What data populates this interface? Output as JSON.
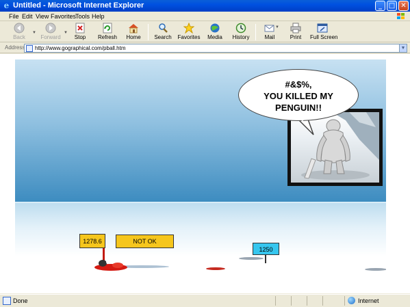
{
  "window": {
    "title": "Untitled - Microsoft Internet Explorer",
    "minimize_glyph": "_",
    "maximize_glyph": "□",
    "close_glyph": "✕"
  },
  "menu": {
    "items": [
      "File",
      "Edit",
      "View",
      "Favorites",
      "Tools",
      "Help"
    ]
  },
  "toolbar": {
    "back": "Back",
    "forward": "Forward",
    "stop": "Stop",
    "refresh": "Refresh",
    "home": "Home",
    "search": "Search",
    "favorites": "Favorites",
    "media": "Media",
    "history": "History",
    "mail": "Mail",
    "print": "Print",
    "fullscreen": "Full Screen"
  },
  "address": {
    "label": "Address",
    "url": "http://www.gographical.com/pball.htm"
  },
  "game": {
    "speech_line1": "#&$%,",
    "speech_line2": "YOU KILLED MY",
    "speech_line3": "PENGUIN!!",
    "distance": "1278.6",
    "result": "NOT OK",
    "target": "1250"
  },
  "status": {
    "text": "Done",
    "zone": "Internet"
  },
  "colors": {
    "sign_yellow": "#f6c61c",
    "sign_cyan": "#36c6ee",
    "blood": "#d41a12",
    "titlebar_blue": "#0050e0"
  }
}
